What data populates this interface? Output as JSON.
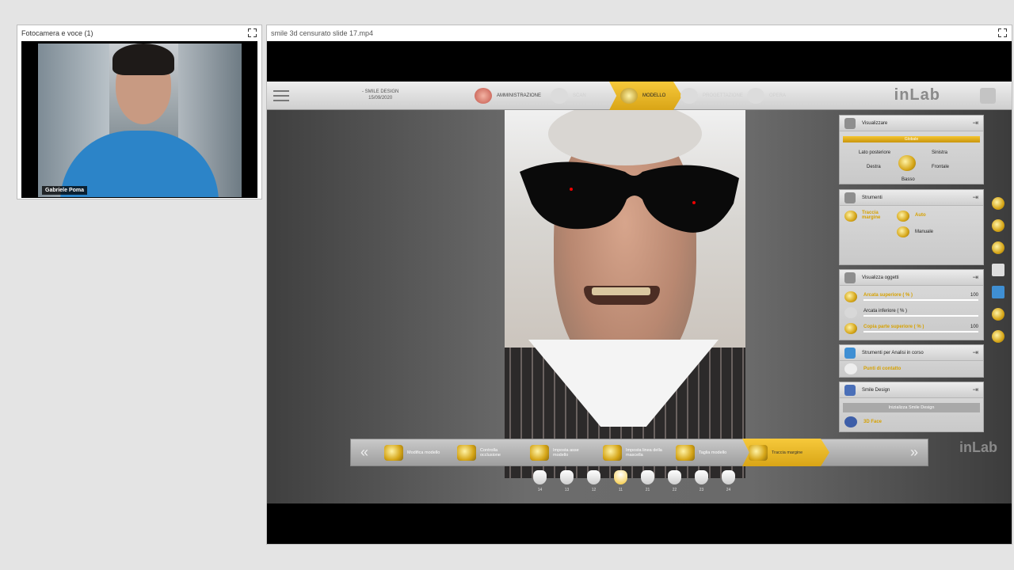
{
  "webcam": {
    "title": "Fotocamera e voce (1)",
    "presenter_name": "Gabriele Poma"
  },
  "video": {
    "title": "smile 3d censurato slide 17.mp4"
  },
  "app": {
    "case_name": "- SMILE DESIGN",
    "case_date": "15/09/2020",
    "steps": [
      {
        "label": "AMMINISTRAZIONE",
        "state": "done"
      },
      {
        "label": "SCAN",
        "state": "faded"
      },
      {
        "label": "MODELLO",
        "state": "active"
      },
      {
        "label": "PROGETTAZIONE",
        "state": "faded"
      },
      {
        "label": "OPERA",
        "state": "faded"
      }
    ],
    "logo": "inLab",
    "panels": {
      "visualizzare": {
        "title": "Visualizzare",
        "global_label": "Globale",
        "views": [
          "Lato posteriore",
          "Sinistra",
          "Destra",
          "Frontale",
          "Basso"
        ]
      },
      "strumenti": {
        "title": "Strumenti",
        "tool_label": "Traccia margine",
        "options": [
          "Auto",
          "Manuale"
        ]
      },
      "oggetti": {
        "title": "Visualizza oggetti",
        "items": [
          {
            "label": "Arcata superiore ( % )",
            "value": "100",
            "highlight": true
          },
          {
            "label": "Arcata inferiore ( % )",
            "value": "",
            "highlight": false
          },
          {
            "label": "Copia parte superiore ( % )",
            "value": "100",
            "highlight": true
          }
        ]
      },
      "analisi": {
        "title": "Strumenti per Analisi in corso",
        "item": "Punti di contatto"
      },
      "smile": {
        "title": "Smile Design",
        "button": "Inizializza Smile Design",
        "item": "3D Face"
      }
    },
    "toolbar": [
      {
        "label": "Modifica modello",
        "active": false
      },
      {
        "label": "Controlla occlusione",
        "active": false
      },
      {
        "label": "Imposta asse modello",
        "active": false
      },
      {
        "label": "Imposta linea della mascella",
        "active": false
      },
      {
        "label": "Taglia modello",
        "active": false
      },
      {
        "label": "Traccia margine",
        "active": true
      }
    ],
    "teeth": [
      "14",
      "13",
      "12",
      "11",
      "21",
      "22",
      "23",
      "24"
    ],
    "selected_tooth": "11"
  }
}
